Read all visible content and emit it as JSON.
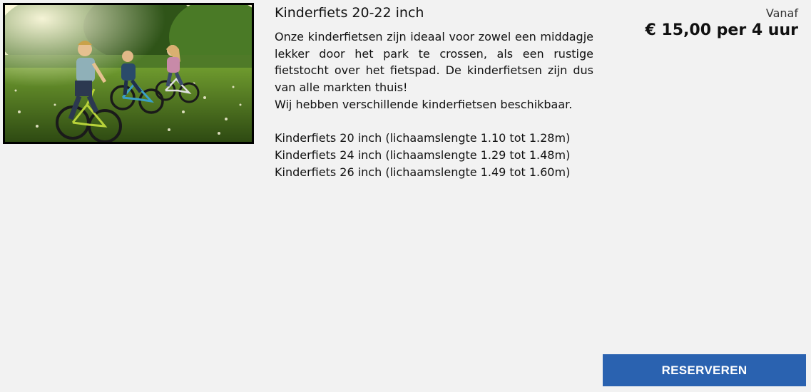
{
  "product": {
    "title": "Kinderfiets 20-22 inch",
    "image_alt": "Kinderen fietsen door een grasveld in het park",
    "description": [
      "Onze kinderfietsen zijn ideaal voor zowel een middagje lekker door het park te crossen, als een rustige fietstocht over het fietspad. De kinderfietsen zijn dus van alle markten thuis!",
      "Wij hebben verschillende kinderfietsen beschikbaar."
    ],
    "sizes": [
      "Kinderfiets 20 inch (lichaamslengte 1.10 tot 1.28m)",
      "Kinderfiets 24 inch (lichaamslengte 1.29 tot 1.48m)",
      "Kinderfiets 26 inch (lichaamslengte 1.49 tot 1.60m)"
    ]
  },
  "pricing": {
    "prefix": "Vanaf",
    "price": "€ 15,00 per 4 uur"
  },
  "actions": {
    "reserve_label": "RESERVEREN"
  },
  "colors": {
    "background": "#f2f2f2",
    "button": "#2a62b0",
    "button_text": "#ffffff"
  }
}
